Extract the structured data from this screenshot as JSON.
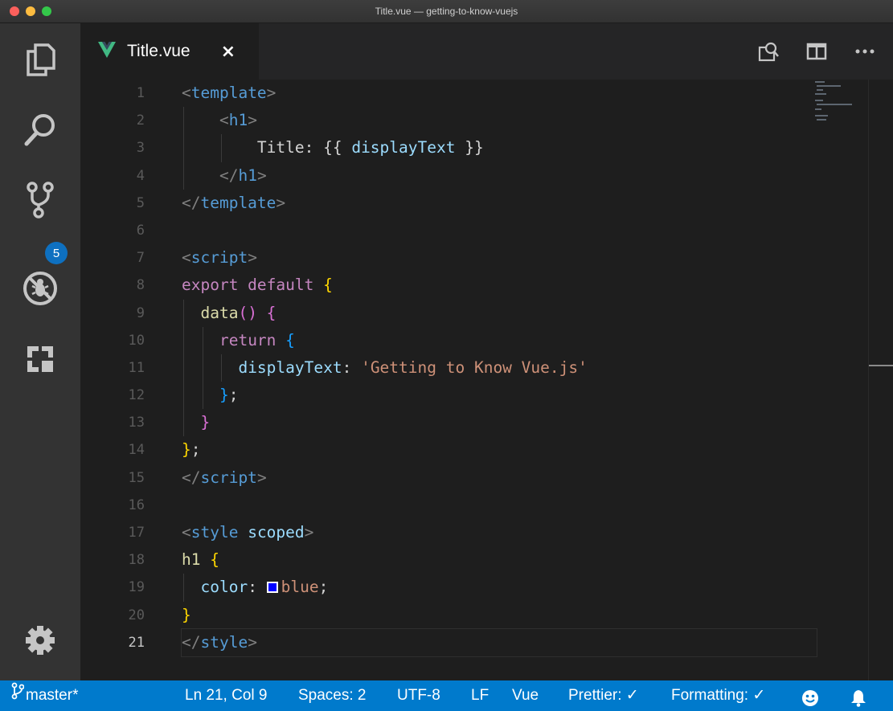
{
  "window": {
    "title": "Title.vue — getting-to-know-vuejs"
  },
  "activity_bar": {
    "items": [
      "explorer-icon",
      "search-icon",
      "source-control-icon",
      "debug-icon",
      "extensions-icon",
      "settings-gear-icon"
    ],
    "source_control_badge": "5"
  },
  "tab": {
    "label": "Title.vue",
    "close": "×",
    "icon": "vue-logo-icon"
  },
  "tab_actions": [
    "open-preview-icon",
    "split-editor-icon",
    "more-actions-icon"
  ],
  "editor": {
    "current_line": 21,
    "lines": [
      [
        {
          "t": "<",
          "c": "punc"
        },
        {
          "t": "template",
          "c": "tag"
        },
        {
          "t": ">",
          "c": "punc"
        }
      ],
      [
        {
          "t": "    "
        },
        {
          "t": "<",
          "c": "punc"
        },
        {
          "t": "h1",
          "c": "tag"
        },
        {
          "t": ">",
          "c": "punc"
        }
      ],
      [
        {
          "t": "        "
        },
        {
          "t": "Title: {{ ",
          "c": "txt"
        },
        {
          "t": "displayText",
          "c": "prop"
        },
        {
          "t": " }}",
          "c": "txt"
        }
      ],
      [
        {
          "t": "    "
        },
        {
          "t": "</",
          "c": "punc"
        },
        {
          "t": "h1",
          "c": "tag"
        },
        {
          "t": ">",
          "c": "punc"
        }
      ],
      [
        {
          "t": "</",
          "c": "punc"
        },
        {
          "t": "template",
          "c": "tag"
        },
        {
          "t": ">",
          "c": "punc"
        }
      ],
      [],
      [
        {
          "t": "<",
          "c": "punc"
        },
        {
          "t": "script",
          "c": "tag"
        },
        {
          "t": ">",
          "c": "punc"
        }
      ],
      [
        {
          "t": "export default ",
          "c": "kw"
        },
        {
          "t": "{",
          "c": "br1"
        }
      ],
      [
        {
          "t": "  "
        },
        {
          "t": "data",
          "c": "fn"
        },
        {
          "t": "() {",
          "c": "br2"
        }
      ],
      [
        {
          "t": "    "
        },
        {
          "t": "return ",
          "c": "kw"
        },
        {
          "t": "{",
          "c": "br3"
        }
      ],
      [
        {
          "t": "      "
        },
        {
          "t": "displayText",
          "c": "prop"
        },
        {
          "t": ": ",
          "c": "txt"
        },
        {
          "t": "'Getting to Know Vue.js'",
          "c": "str"
        }
      ],
      [
        {
          "t": "    "
        },
        {
          "t": "}",
          "c": "br3"
        },
        {
          "t": ";",
          "c": "txt"
        }
      ],
      [
        {
          "t": "  "
        },
        {
          "t": "}",
          "c": "br2"
        }
      ],
      [
        {
          "t": "}",
          "c": "br1"
        },
        {
          "t": ";",
          "c": "txt"
        }
      ],
      [
        {
          "t": "</",
          "c": "punc"
        },
        {
          "t": "script",
          "c": "tag"
        },
        {
          "t": ">",
          "c": "punc"
        }
      ],
      [],
      [
        {
          "t": "<",
          "c": "punc"
        },
        {
          "t": "style",
          "c": "tag"
        },
        {
          "t": " "
        },
        {
          "t": "scoped",
          "c": "attr"
        },
        {
          "t": ">",
          "c": "punc"
        }
      ],
      [
        {
          "t": "h1",
          "c": "fn"
        },
        {
          "t": " "
        },
        {
          "t": "{",
          "c": "br1"
        }
      ],
      [
        {
          "t": "  "
        },
        {
          "t": "color",
          "c": "prop"
        },
        {
          "t": ": ",
          "c": "txt"
        },
        {
          "t": "",
          "c": "swatch"
        },
        {
          "t": "blue",
          "c": "str"
        },
        {
          "t": ";",
          "c": "txt"
        }
      ],
      [
        {
          "t": "}",
          "c": "br1"
        }
      ],
      [
        {
          "t": "</",
          "c": "punc"
        },
        {
          "t": "style",
          "c": "tag"
        },
        {
          "t": ">",
          "c": "punc"
        }
      ]
    ]
  },
  "status_bar": {
    "branch": "master*",
    "position": "Ln 21, Col 9",
    "spaces": "Spaces: 2",
    "encoding": "UTF-8",
    "eol": "LF",
    "language": "Vue",
    "prettier": "Prettier: ✓",
    "formatting": "Formatting: ✓",
    "icons": [
      "branch-icon",
      "feedback-smiley-icon",
      "notifications-bell-icon"
    ]
  },
  "colors": {
    "status_bar": "#007acc",
    "activity_bar": "#333333",
    "editor_bg": "#1e1e1e",
    "badge": "#0e70c0",
    "vue_green": "#41b883"
  }
}
